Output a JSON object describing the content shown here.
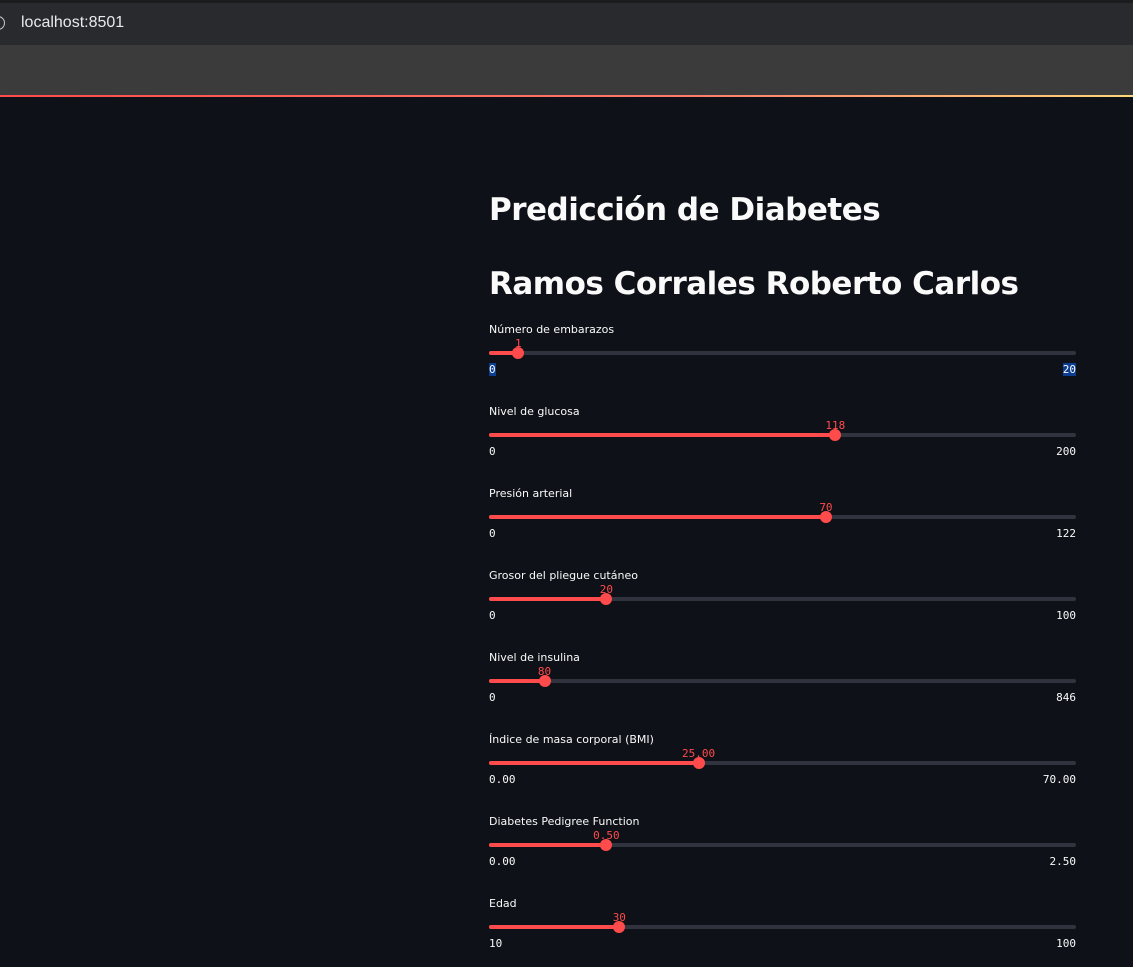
{
  "browser": {
    "url": "localhost:8501"
  },
  "app": {
    "title": "Predicción de Diabetes",
    "author": "Ramos Corrales Roberto Carlos",
    "accent_color": "#ff4b4b",
    "background_color": "#0e1117"
  },
  "sliders": [
    {
      "label": "Número de embarazos",
      "value": "1",
      "min": "0",
      "max": "20",
      "fraction": 0.05
    },
    {
      "label": "Nivel de glucosa",
      "value": "118",
      "min": "0",
      "max": "200",
      "fraction": 0.59
    },
    {
      "label": "Presión arterial",
      "value": "70",
      "min": "0",
      "max": "122",
      "fraction": 0.574
    },
    {
      "label": "Grosor del pliegue cutáneo",
      "value": "20",
      "min": "0",
      "max": "100",
      "fraction": 0.2
    },
    {
      "label": "Nivel de insulina",
      "value": "80",
      "min": "0",
      "max": "846",
      "fraction": 0.0946
    },
    {
      "label": "Índice de masa corporal (BMI)",
      "value": "25.00",
      "min": "0.00",
      "max": "70.00",
      "fraction": 0.357
    },
    {
      "label": "Diabetes Pedigree Function",
      "value": "0.50",
      "min": "0.00",
      "max": "2.50",
      "fraction": 0.2
    },
    {
      "label": "Edad",
      "value": "30",
      "min": "10",
      "max": "100",
      "fraction": 0.222
    }
  ]
}
